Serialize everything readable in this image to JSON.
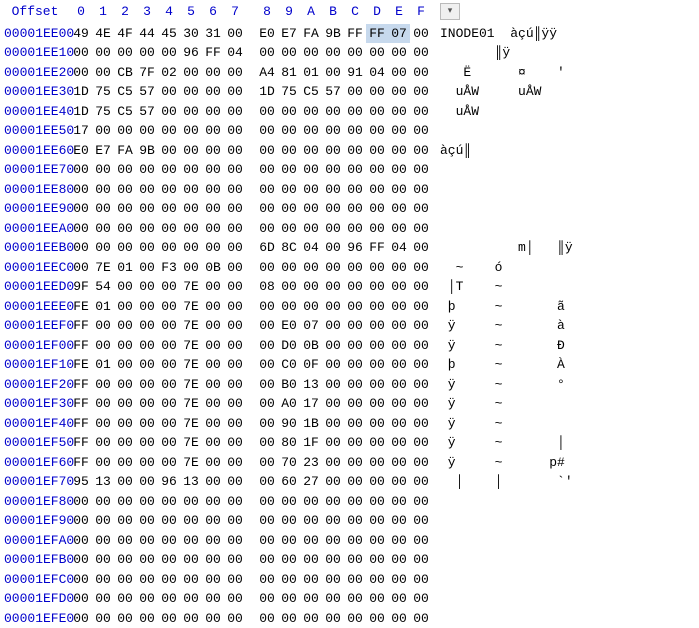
{
  "header": {
    "offset_label": "Offset",
    "columns": [
      "0",
      "1",
      "2",
      "3",
      "4",
      "5",
      "6",
      "7",
      "8",
      "9",
      "A",
      "B",
      "C",
      "D",
      "E",
      "F"
    ]
  },
  "rows": [
    {
      "offset": "00001EE00",
      "hex": [
        "49",
        "4E",
        "4F",
        "44",
        "45",
        "30",
        "31",
        "00",
        "E0",
        "E7",
        "FA",
        "9B",
        "FF",
        "FF",
        "07",
        "00"
      ],
      "ascii": "INODE01  àçú║ÿÿ"
    },
    {
      "offset": "00001EE10",
      "hex": [
        "00",
        "00",
        "00",
        "00",
        "00",
        "96",
        "FF",
        "04",
        "00",
        "00",
        "00",
        "00",
        "00",
        "00",
        "00",
        "00"
      ],
      "ascii": "       ║ÿ"
    },
    {
      "offset": "00001EE20",
      "hex": [
        "00",
        "00",
        "CB",
        "7F",
        "02",
        "00",
        "00",
        "00",
        "A4",
        "81",
        "01",
        "00",
        "91",
        "04",
        "00",
        "00"
      ],
      "ascii": "   Ë      ¤    '"
    },
    {
      "offset": "00001EE30",
      "hex": [
        "1D",
        "75",
        "C5",
        "57",
        "00",
        "00",
        "00",
        "00",
        "1D",
        "75",
        "C5",
        "57",
        "00",
        "00",
        "00",
        "00"
      ],
      "ascii": "  uÅW     uÅW"
    },
    {
      "offset": "00001EE40",
      "hex": [
        "1D",
        "75",
        "C5",
        "57",
        "00",
        "00",
        "00",
        "00",
        "00",
        "00",
        "00",
        "00",
        "00",
        "00",
        "00",
        "00"
      ],
      "ascii": "  uÅW"
    },
    {
      "offset": "00001EE50",
      "hex": [
        "17",
        "00",
        "00",
        "00",
        "00",
        "00",
        "00",
        "00",
        "00",
        "00",
        "00",
        "00",
        "00",
        "00",
        "00",
        "00"
      ],
      "ascii": ""
    },
    {
      "offset": "00001EE60",
      "hex": [
        "E0",
        "E7",
        "FA",
        "9B",
        "00",
        "00",
        "00",
        "00",
        "00",
        "00",
        "00",
        "00",
        "00",
        "00",
        "00",
        "00"
      ],
      "ascii": "àçú║"
    },
    {
      "offset": "00001EE70",
      "hex": [
        "00",
        "00",
        "00",
        "00",
        "00",
        "00",
        "00",
        "00",
        "00",
        "00",
        "00",
        "00",
        "00",
        "00",
        "00",
        "00"
      ],
      "ascii": ""
    },
    {
      "offset": "00001EE80",
      "hex": [
        "00",
        "00",
        "00",
        "00",
        "00",
        "00",
        "00",
        "00",
        "00",
        "00",
        "00",
        "00",
        "00",
        "00",
        "00",
        "00"
      ],
      "ascii": ""
    },
    {
      "offset": "00001EE90",
      "hex": [
        "00",
        "00",
        "00",
        "00",
        "00",
        "00",
        "00",
        "00",
        "00",
        "00",
        "00",
        "00",
        "00",
        "00",
        "00",
        "00"
      ],
      "ascii": ""
    },
    {
      "offset": "00001EEA0",
      "hex": [
        "00",
        "00",
        "00",
        "00",
        "00",
        "00",
        "00",
        "00",
        "00",
        "00",
        "00",
        "00",
        "00",
        "00",
        "00",
        "00"
      ],
      "ascii": ""
    },
    {
      "offset": "00001EEB0",
      "hex": [
        "00",
        "00",
        "00",
        "00",
        "00",
        "00",
        "00",
        "00",
        "6D",
        "8C",
        "04",
        "00",
        "96",
        "FF",
        "04",
        "00"
      ],
      "ascii": "          m│   ║ÿ"
    },
    {
      "offset": "00001EEC0",
      "hex": [
        "00",
        "7E",
        "01",
        "00",
        "F3",
        "00",
        "0B",
        "00",
        "00",
        "00",
        "00",
        "00",
        "00",
        "00",
        "00",
        "00"
      ],
      "ascii": "  ~    ó"
    },
    {
      "offset": "00001EED0",
      "hex": [
        "9F",
        "54",
        "00",
        "00",
        "00",
        "7E",
        "00",
        "00",
        "08",
        "00",
        "00",
        "00",
        "00",
        "00",
        "00",
        "00"
      ],
      "ascii": " │T    ~"
    },
    {
      "offset": "00001EEE0",
      "hex": [
        "FE",
        "01",
        "00",
        "00",
        "00",
        "7E",
        "00",
        "00",
        "00",
        "00",
        "00",
        "00",
        "00",
        "00",
        "00",
        "00"
      ],
      "ascii": " þ     ~       ã"
    },
    {
      "offset": "00001EEF0",
      "hex": [
        "FF",
        "00",
        "00",
        "00",
        "00",
        "7E",
        "00",
        "00",
        "00",
        "E0",
        "07",
        "00",
        "00",
        "00",
        "00",
        "00"
      ],
      "ascii": " ÿ     ~       à"
    },
    {
      "offset": "00001EF00",
      "hex": [
        "FF",
        "00",
        "00",
        "00",
        "00",
        "7E",
        "00",
        "00",
        "00",
        "D0",
        "0B",
        "00",
        "00",
        "00",
        "00",
        "00"
      ],
      "ascii": " ÿ     ~       Ð"
    },
    {
      "offset": "00001EF10",
      "hex": [
        "FE",
        "01",
        "00",
        "00",
        "00",
        "7E",
        "00",
        "00",
        "00",
        "C0",
        "0F",
        "00",
        "00",
        "00",
        "00",
        "00"
      ],
      "ascii": " þ     ~       À"
    },
    {
      "offset": "00001EF20",
      "hex": [
        "FF",
        "00",
        "00",
        "00",
        "00",
        "7E",
        "00",
        "00",
        "00",
        "B0",
        "13",
        "00",
        "00",
        "00",
        "00",
        "00"
      ],
      "ascii": " ÿ     ~       °"
    },
    {
      "offset": "00001EF30",
      "hex": [
        "FF",
        "00",
        "00",
        "00",
        "00",
        "7E",
        "00",
        "00",
        "00",
        "A0",
        "17",
        "00",
        "00",
        "00",
        "00",
        "00"
      ],
      "ascii": " ÿ     ~"
    },
    {
      "offset": "00001EF40",
      "hex": [
        "FF",
        "00",
        "00",
        "00",
        "00",
        "7E",
        "00",
        "00",
        "00",
        "90",
        "1B",
        "00",
        "00",
        "00",
        "00",
        "00"
      ],
      "ascii": " ÿ     ~"
    },
    {
      "offset": "00001EF50",
      "hex": [
        "FF",
        "00",
        "00",
        "00",
        "00",
        "7E",
        "00",
        "00",
        "00",
        "80",
        "1F",
        "00",
        "00",
        "00",
        "00",
        "00"
      ],
      "ascii": " ÿ     ~       │"
    },
    {
      "offset": "00001EF60",
      "hex": [
        "FF",
        "00",
        "00",
        "00",
        "00",
        "7E",
        "00",
        "00",
        "00",
        "70",
        "23",
        "00",
        "00",
        "00",
        "00",
        "00"
      ],
      "ascii": " ÿ     ~      p#"
    },
    {
      "offset": "00001EF70",
      "hex": [
        "95",
        "13",
        "00",
        "00",
        "96",
        "13",
        "00",
        "00",
        "00",
        "60",
        "27",
        "00",
        "00",
        "00",
        "00",
        "00"
      ],
      "ascii": "  │    │       `'"
    },
    {
      "offset": "00001EF80",
      "hex": [
        "00",
        "00",
        "00",
        "00",
        "00",
        "00",
        "00",
        "00",
        "00",
        "00",
        "00",
        "00",
        "00",
        "00",
        "00",
        "00"
      ],
      "ascii": ""
    },
    {
      "offset": "00001EF90",
      "hex": [
        "00",
        "00",
        "00",
        "00",
        "00",
        "00",
        "00",
        "00",
        "00",
        "00",
        "00",
        "00",
        "00",
        "00",
        "00",
        "00"
      ],
      "ascii": ""
    },
    {
      "offset": "00001EFA0",
      "hex": [
        "00",
        "00",
        "00",
        "00",
        "00",
        "00",
        "00",
        "00",
        "00",
        "00",
        "00",
        "00",
        "00",
        "00",
        "00",
        "00"
      ],
      "ascii": ""
    },
    {
      "offset": "00001EFB0",
      "hex": [
        "00",
        "00",
        "00",
        "00",
        "00",
        "00",
        "00",
        "00",
        "00",
        "00",
        "00",
        "00",
        "00",
        "00",
        "00",
        "00"
      ],
      "ascii": ""
    },
    {
      "offset": "00001EFC0",
      "hex": [
        "00",
        "00",
        "00",
        "00",
        "00",
        "00",
        "00",
        "00",
        "00",
        "00",
        "00",
        "00",
        "00",
        "00",
        "00",
        "00"
      ],
      "ascii": ""
    },
    {
      "offset": "00001EFD0",
      "hex": [
        "00",
        "00",
        "00",
        "00",
        "00",
        "00",
        "00",
        "00",
        "00",
        "00",
        "00",
        "00",
        "00",
        "00",
        "00",
        "00"
      ],
      "ascii": ""
    },
    {
      "offset": "00001EFE0",
      "hex": [
        "00",
        "00",
        "00",
        "00",
        "00",
        "00",
        "00",
        "00",
        "00",
        "00",
        "00",
        "00",
        "00",
        "00",
        "00",
        "00"
      ],
      "ascii": ""
    }
  ],
  "selection": {
    "row": 0,
    "start": 13,
    "end": 14
  }
}
